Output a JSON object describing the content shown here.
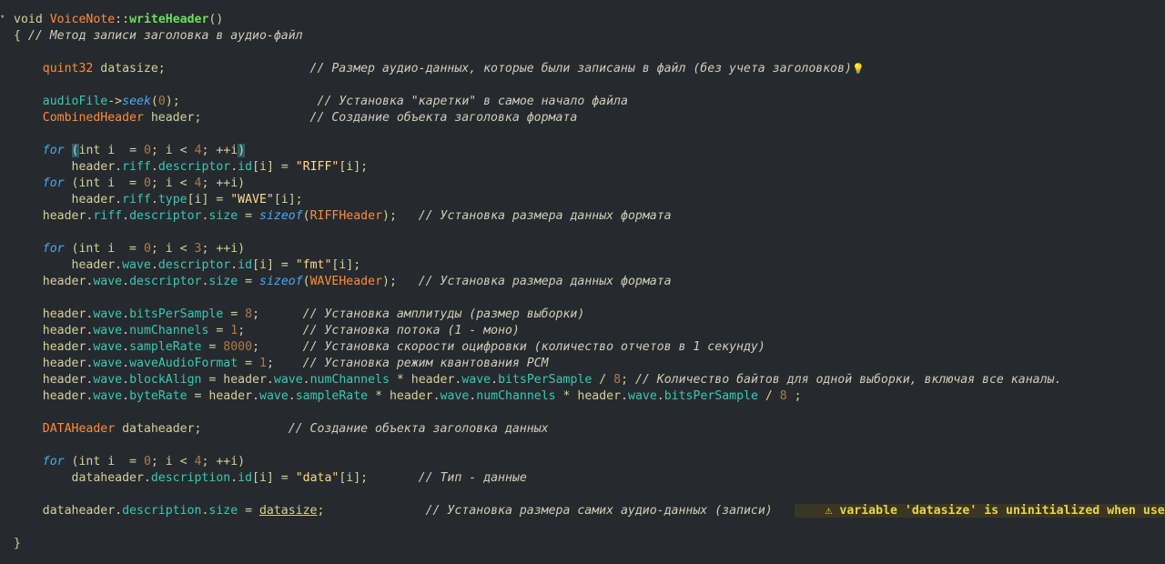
{
  "editor": {
    "fold_marker": "▾",
    "hint_icon": "lightbulb-icon",
    "warning_icon": "warning-triangle-icon",
    "lines": [
      [
        [
          "pl",
          "void "
        ],
        [
          "ty",
          "VoiceNote"
        ],
        [
          "pl",
          "::"
        ],
        [
          "fn",
          "writeHeader"
        ],
        [
          "pl",
          "()"
        ]
      ],
      [
        [
          "pl",
          "{ "
        ],
        [
          "cm",
          "// Метод записи заголовка в аудио-файл"
        ]
      ],
      [],
      [
        [
          "pl",
          "    "
        ],
        [
          "ty",
          "quint32"
        ],
        [
          "pl",
          " datasize;                    "
        ],
        [
          "cm",
          "// Размер аудио-данных, которые были записаны в файл (без учета заголовков)"
        ],
        [
          "bulb",
          "💡"
        ]
      ],
      [],
      [
        [
          "pl",
          "    "
        ],
        [
          "mem",
          "audioFile"
        ],
        [
          "pl",
          "->"
        ],
        [
          "fi",
          "seek"
        ],
        [
          "pl",
          "("
        ],
        [
          "num",
          "0"
        ],
        [
          "pl",
          ");                   "
        ],
        [
          "cm",
          "// Установка \"каретки\" в самое начало файла"
        ]
      ],
      [
        [
          "pl",
          "    "
        ],
        [
          "ty",
          "CombinedHeader"
        ],
        [
          "pl",
          " header;               "
        ],
        [
          "cm",
          "// Создание объекта заголовка формата"
        ]
      ],
      [],
      [
        [
          "pl",
          "    "
        ],
        [
          "kw",
          "for"
        ],
        [
          "pl",
          " "
        ],
        [
          "hl",
          "("
        ],
        [
          "pl",
          "int i  = "
        ],
        [
          "num",
          "0"
        ],
        [
          "pl",
          "; i < "
        ],
        [
          "num",
          "4"
        ],
        [
          "pl",
          "; ++i"
        ],
        [
          "hl",
          ")"
        ]
      ],
      [
        [
          "pl",
          "        header."
        ],
        [
          "mem",
          "riff"
        ],
        [
          "pl",
          "."
        ],
        [
          "mem",
          "descriptor"
        ],
        [
          "pl",
          "."
        ],
        [
          "mem",
          "id"
        ],
        [
          "pl",
          "[i] = "
        ],
        [
          "str",
          "\"RIFF\""
        ],
        [
          "pl",
          "[i];"
        ]
      ],
      [
        [
          "pl",
          "    "
        ],
        [
          "kw",
          "for"
        ],
        [
          "pl",
          " (int i  = "
        ],
        [
          "num",
          "0"
        ],
        [
          "pl",
          "; i < "
        ],
        [
          "num",
          "4"
        ],
        [
          "pl",
          "; ++i)"
        ]
      ],
      [
        [
          "pl",
          "        header."
        ],
        [
          "mem",
          "riff"
        ],
        [
          "pl",
          "."
        ],
        [
          "mem",
          "type"
        ],
        [
          "pl",
          "[i] = "
        ],
        [
          "str",
          "\"WAVE\""
        ],
        [
          "pl",
          "[i];"
        ]
      ],
      [
        [
          "pl",
          "    header."
        ],
        [
          "mem",
          "riff"
        ],
        [
          "pl",
          "."
        ],
        [
          "mem",
          "descriptor"
        ],
        [
          "pl",
          "."
        ],
        [
          "mem",
          "size"
        ],
        [
          "pl",
          " = "
        ],
        [
          "fi",
          "sizeof"
        ],
        [
          "pl",
          "("
        ],
        [
          "ty",
          "RIFFHeader"
        ],
        [
          "pl",
          ");   "
        ],
        [
          "cm",
          "// Установка размера данных формата"
        ]
      ],
      [],
      [
        [
          "pl",
          "    "
        ],
        [
          "kw",
          "for"
        ],
        [
          "pl",
          " (int i  = "
        ],
        [
          "num",
          "0"
        ],
        [
          "pl",
          "; i < "
        ],
        [
          "num",
          "3"
        ],
        [
          "pl",
          "; ++i)"
        ]
      ],
      [
        [
          "pl",
          "        header."
        ],
        [
          "mem",
          "wave"
        ],
        [
          "pl",
          "."
        ],
        [
          "mem",
          "descriptor"
        ],
        [
          "pl",
          "."
        ],
        [
          "mem",
          "id"
        ],
        [
          "pl",
          "[i] = "
        ],
        [
          "str",
          "\"fmt\""
        ],
        [
          "pl",
          "[i];"
        ]
      ],
      [
        [
          "pl",
          "    header."
        ],
        [
          "mem",
          "wave"
        ],
        [
          "pl",
          "."
        ],
        [
          "mem",
          "descriptor"
        ],
        [
          "pl",
          "."
        ],
        [
          "mem",
          "size"
        ],
        [
          "pl",
          " = "
        ],
        [
          "fi",
          "sizeof"
        ],
        [
          "pl",
          "("
        ],
        [
          "ty",
          "WAVEHeader"
        ],
        [
          "pl",
          ");   "
        ],
        [
          "cm",
          "// Установка размера данных формата"
        ]
      ],
      [],
      [
        [
          "pl",
          "    header."
        ],
        [
          "mem",
          "wave"
        ],
        [
          "pl",
          "."
        ],
        [
          "mem",
          "bitsPerSample"
        ],
        [
          "pl",
          " = "
        ],
        [
          "num",
          "8"
        ],
        [
          "pl",
          ";      "
        ],
        [
          "cm",
          "// Установка амплитуды (размер выборки)"
        ]
      ],
      [
        [
          "pl",
          "    header."
        ],
        [
          "mem",
          "wave"
        ],
        [
          "pl",
          "."
        ],
        [
          "mem",
          "numChannels"
        ],
        [
          "pl",
          " = "
        ],
        [
          "num",
          "1"
        ],
        [
          "pl",
          ";        "
        ],
        [
          "cm",
          "// Установка потока (1 - моно)"
        ]
      ],
      [
        [
          "pl",
          "    header."
        ],
        [
          "mem",
          "wave"
        ],
        [
          "pl",
          "."
        ],
        [
          "mem",
          "sampleRate"
        ],
        [
          "pl",
          " = "
        ],
        [
          "num",
          "8000"
        ],
        [
          "pl",
          ";      "
        ],
        [
          "cm",
          "// Установка скорости оцифровки (количество отчетов в 1 секунду)"
        ]
      ],
      [
        [
          "pl",
          "    header."
        ],
        [
          "mem",
          "wave"
        ],
        [
          "pl",
          "."
        ],
        [
          "mem",
          "waveAudioFormat"
        ],
        [
          "pl",
          " = "
        ],
        [
          "num",
          "1"
        ],
        [
          "pl",
          ";    "
        ],
        [
          "cm",
          "// Установка режим квантования PCM"
        ]
      ],
      [
        [
          "pl",
          "    header."
        ],
        [
          "mem",
          "wave"
        ],
        [
          "pl",
          "."
        ],
        [
          "mem",
          "blockAlign"
        ],
        [
          "pl",
          " = header."
        ],
        [
          "mem",
          "wave"
        ],
        [
          "pl",
          "."
        ],
        [
          "mem",
          "numChannels"
        ],
        [
          "pl",
          " * header."
        ],
        [
          "mem",
          "wave"
        ],
        [
          "pl",
          "."
        ],
        [
          "mem",
          "bitsPerSample"
        ],
        [
          "pl",
          " / "
        ],
        [
          "num",
          "8"
        ],
        [
          "pl",
          "; "
        ],
        [
          "cm",
          "// Количество байтов для одной выборки, включая все каналы."
        ]
      ],
      [
        [
          "pl",
          "    header."
        ],
        [
          "mem",
          "wave"
        ],
        [
          "pl",
          "."
        ],
        [
          "mem",
          "byteRate"
        ],
        [
          "pl",
          " = header."
        ],
        [
          "mem",
          "wave"
        ],
        [
          "pl",
          "."
        ],
        [
          "mem",
          "sampleRate"
        ],
        [
          "pl",
          " * header."
        ],
        [
          "mem",
          "wave"
        ],
        [
          "pl",
          "."
        ],
        [
          "mem",
          "numChannels"
        ],
        [
          "pl",
          " * header."
        ],
        [
          "mem",
          "wave"
        ],
        [
          "pl",
          "."
        ],
        [
          "mem",
          "bitsPerSample"
        ],
        [
          "pl",
          " / "
        ],
        [
          "num",
          "8"
        ],
        [
          "pl",
          " ;"
        ]
      ],
      [],
      [
        [
          "pl",
          "    "
        ],
        [
          "ty",
          "DATAHeader"
        ],
        [
          "pl",
          " dataheader;            "
        ],
        [
          "cm",
          "// Создание объекта заголовка данных"
        ]
      ],
      [],
      [
        [
          "pl",
          "    "
        ],
        [
          "kw",
          "for"
        ],
        [
          "pl",
          " (int i  = "
        ],
        [
          "num",
          "0"
        ],
        [
          "pl",
          "; i < "
        ],
        [
          "num",
          "4"
        ],
        [
          "pl",
          "; ++i)"
        ]
      ],
      [
        [
          "pl",
          "        dataheader."
        ],
        [
          "mem",
          "description"
        ],
        [
          "pl",
          "."
        ],
        [
          "mem",
          "id"
        ],
        [
          "pl",
          "[i] = "
        ],
        [
          "str",
          "\"data\""
        ],
        [
          "pl",
          "[i];       "
        ],
        [
          "cm",
          "// Тип - данные"
        ]
      ],
      [],
      [
        [
          "pl",
          "    dataheader."
        ],
        [
          "mem",
          "description"
        ],
        [
          "pl",
          "."
        ],
        [
          "mem",
          "size"
        ],
        [
          "pl",
          " = "
        ],
        [
          "und",
          "datasize"
        ],
        [
          "pl",
          ";              "
        ],
        [
          "cm",
          "// Установка размера самих аудио-данных (записи)"
        ],
        [
          "pl",
          "   "
        ],
        [
          "warn",
          "⚠ variable 'datasize' is uninitialized when used here"
        ]
      ],
      [],
      [
        [
          "pl",
          "}"
        ]
      ]
    ]
  }
}
